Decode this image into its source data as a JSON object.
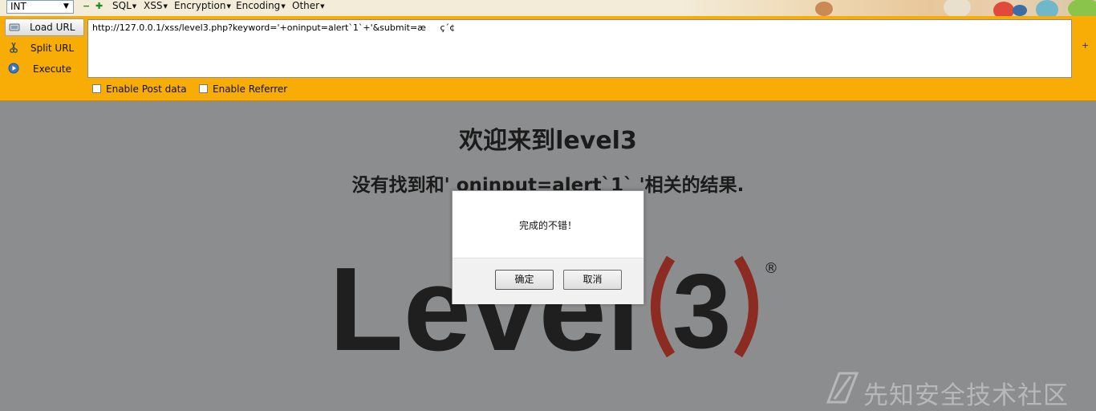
{
  "hackbar": {
    "select_value": "INT",
    "menus": [
      "SQL",
      "XSS",
      "Encryption",
      "Encoding",
      "Other"
    ],
    "buttons": {
      "load_url": "Load URL",
      "split_url": "Split URL",
      "execute": "Execute"
    },
    "url_value": "http://127.0.0.1/xss/level3.php?keyword='+oninput=alert`1`+'&submit=æç´¢",
    "checkboxes": {
      "post_data": "Enable Post data",
      "referrer": "Enable Referrer"
    },
    "scroll_plus": "+"
  },
  "page": {
    "heading": "欢迎来到level3",
    "result": "没有找到和' oninput=alert`1` '相关的结果.",
    "logo_text": "Level",
    "logo_number": "3",
    "logo_registered": "®"
  },
  "dialog": {
    "message": "完成的不错！",
    "ok_label": "确定",
    "cancel_label": "取消"
  },
  "watermark": {
    "text": "先知安全技术社区"
  },
  "colors": {
    "toolbar_orange": "#f8ad06",
    "page_dim": "#8c8d8e",
    "logo_dark": "#1f1f1f",
    "logo_red": "#8b2b22"
  }
}
